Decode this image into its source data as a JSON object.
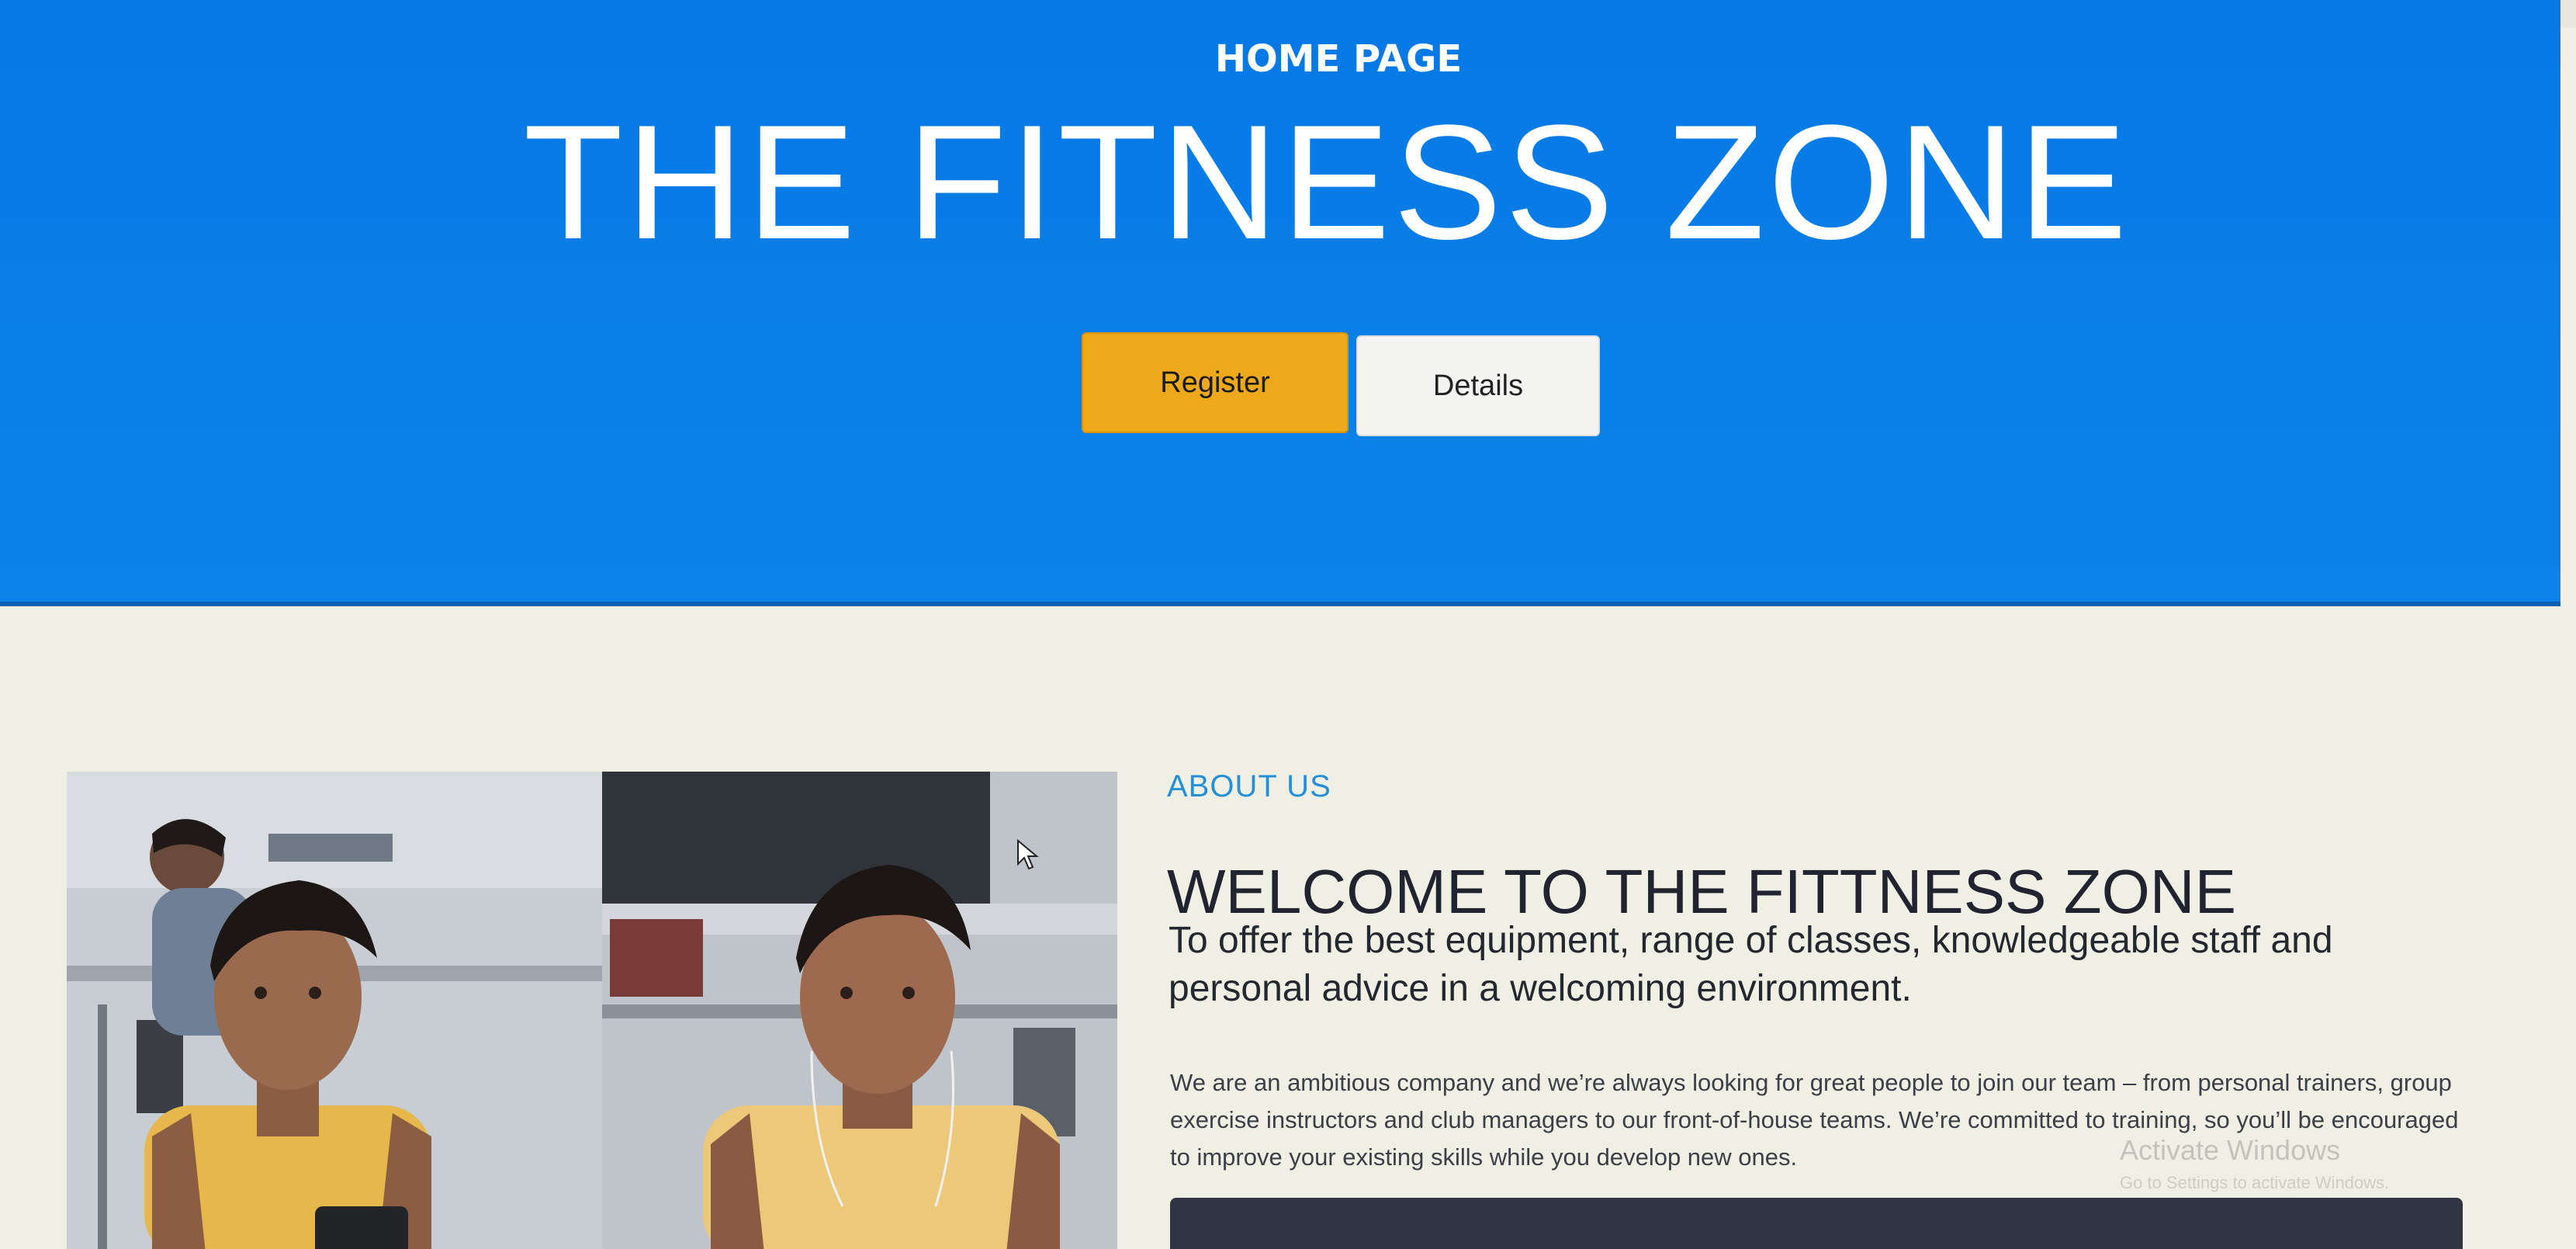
{
  "hero": {
    "label": "HOME PAGE",
    "title": "THE FITNESS ZONE",
    "register_label": "Register",
    "details_label": "Details"
  },
  "about": {
    "kicker": "ABOUT US",
    "heading": "WELCOME TO THE FITTNESS ZONE",
    "lead": "To offer the best equipment, range of classes, knowledgeable staff and personal advice in a welcoming environment.",
    "body": "We are an ambitious company and we’re always looking for great people to join our team – from personal trainers, group exercise instructors and club managers to our front-of-house teams. We’re committed to training, so you’ll be encouraged to improve your existing skills while you develop new ones."
  },
  "overlay": {
    "watermark_title": "Activate Windows",
    "watermark_sub": "Go to Settings to activate Windows."
  },
  "colors": {
    "hero_blue": "#087de6",
    "register_orange": "#eea91b",
    "kicker_blue": "#2590d6"
  },
  "icons": {
    "browser_toolbar": [
      "extension-icon",
      "favorites-icon",
      "collections-icon",
      "share-icon",
      "profile-avatar",
      "more-icon"
    ]
  }
}
